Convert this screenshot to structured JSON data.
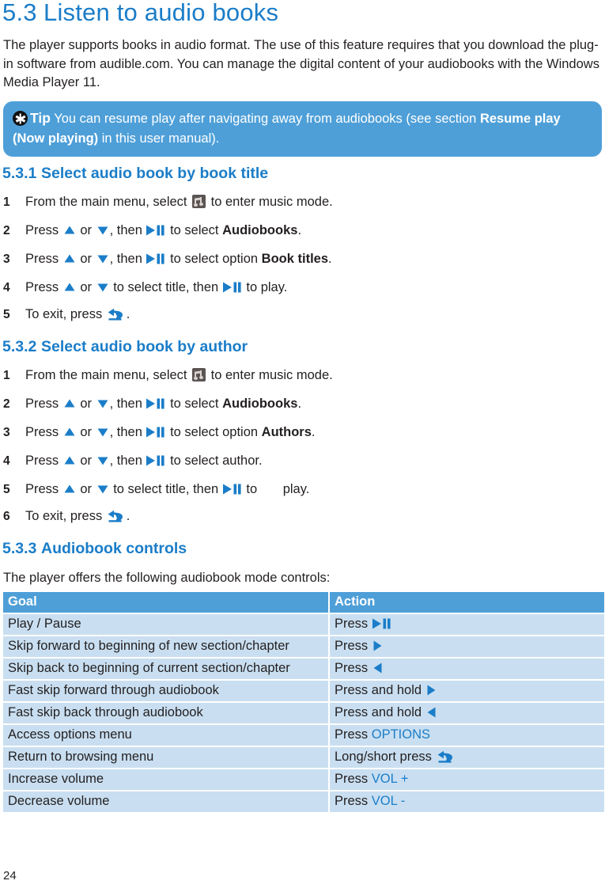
{
  "colors": {
    "heading_blue": "#1b7dc8",
    "tip_bg": "#4e9fd8",
    "table_header_bg": "#4e9fd8",
    "table_row_bg": "#c9dff1",
    "text": "#231f20",
    "music_icon_bg": "#5a5453"
  },
  "section": {
    "number": "5.3",
    "title": "Listen to audio books",
    "intro": "The player supports books in audio format. The use of this feature requires that you download the plug-in software from audible.com. You can manage the digital content of your audiobooks with the Windows Media Player 11."
  },
  "tip": {
    "icon": "asterisk-icon",
    "label": "Tip",
    "text_1": "You can resume play after navigating away from audiobooks (see section ",
    "bold_1": "Resume play (Now playing)",
    "text_2": " in this user manual)."
  },
  "subsections": [
    {
      "number": "5.3.1",
      "title": "Select audio book by book title",
      "steps": [
        {
          "n": "1",
          "parts": [
            {
              "t": "text",
              "v": "From the main menu, select "
            },
            {
              "t": "icon",
              "v": "music-mode-icon"
            },
            {
              "t": "text",
              "v": " to enter music mode."
            }
          ]
        },
        {
          "n": "2",
          "parts": [
            {
              "t": "text",
              "v": "Press "
            },
            {
              "t": "icon",
              "v": "arrow-up-icon"
            },
            {
              "t": "text",
              "v": " or "
            },
            {
              "t": "icon",
              "v": "arrow-down-icon"
            },
            {
              "t": "text",
              "v": ", then "
            },
            {
              "t": "icon",
              "v": "play-pause-icon"
            },
            {
              "t": "text",
              "v": " to select "
            },
            {
              "t": "bold",
              "v": "Audiobooks"
            },
            {
              "t": "text",
              "v": "."
            }
          ]
        },
        {
          "n": "3",
          "parts": [
            {
              "t": "text",
              "v": "Press "
            },
            {
              "t": "icon",
              "v": "arrow-up-icon"
            },
            {
              "t": "text",
              "v": " or "
            },
            {
              "t": "icon",
              "v": "arrow-down-icon"
            },
            {
              "t": "text",
              "v": ", then "
            },
            {
              "t": "icon",
              "v": "play-pause-icon"
            },
            {
              "t": "text",
              "v": " to select option "
            },
            {
              "t": "bold",
              "v": "Book titles"
            },
            {
              "t": "text",
              "v": "."
            }
          ]
        },
        {
          "n": "4",
          "parts": [
            {
              "t": "text",
              "v": "Press "
            },
            {
              "t": "icon",
              "v": "arrow-up-icon"
            },
            {
              "t": "text",
              "v": " or "
            },
            {
              "t": "icon",
              "v": "arrow-down-icon"
            },
            {
              "t": "text",
              "v": " to select title, then "
            },
            {
              "t": "icon",
              "v": "play-pause-icon"
            },
            {
              "t": "text",
              "v": " to play."
            }
          ]
        },
        {
          "n": "5",
          "parts": [
            {
              "t": "text",
              "v": "To exit, press "
            },
            {
              "t": "icon",
              "v": "back-arrow-icon"
            },
            {
              "t": "text",
              "v": "."
            }
          ]
        }
      ]
    },
    {
      "number": "5.3.2",
      "title": "Select audio book by author",
      "steps": [
        {
          "n": "1",
          "parts": [
            {
              "t": "text",
              "v": "From the main menu, select "
            },
            {
              "t": "icon",
              "v": "music-mode-icon"
            },
            {
              "t": "text",
              "v": " to enter music mode."
            }
          ]
        },
        {
          "n": "2",
          "parts": [
            {
              "t": "text",
              "v": "Press "
            },
            {
              "t": "icon",
              "v": "arrow-up-icon"
            },
            {
              "t": "text",
              "v": " or "
            },
            {
              "t": "icon",
              "v": "arrow-down-icon"
            },
            {
              "t": "text",
              "v": ", then "
            },
            {
              "t": "icon",
              "v": "play-pause-icon"
            },
            {
              "t": "text",
              "v": " to select "
            },
            {
              "t": "bold",
              "v": "Audiobooks"
            },
            {
              "t": "text",
              "v": "."
            }
          ]
        },
        {
          "n": "3",
          "parts": [
            {
              "t": "text",
              "v": "Press "
            },
            {
              "t": "icon",
              "v": "arrow-up-icon"
            },
            {
              "t": "text",
              "v": " or "
            },
            {
              "t": "icon",
              "v": "arrow-down-icon"
            },
            {
              "t": "text",
              "v": ", then "
            },
            {
              "t": "icon",
              "v": "play-pause-icon"
            },
            {
              "t": "text",
              "v": " to select option "
            },
            {
              "t": "bold",
              "v": "Authors"
            },
            {
              "t": "text",
              "v": "."
            }
          ]
        },
        {
          "n": "4",
          "parts": [
            {
              "t": "text",
              "v": "Press "
            },
            {
              "t": "icon",
              "v": "arrow-up-icon"
            },
            {
              "t": "text",
              "v": " or "
            },
            {
              "t": "icon",
              "v": "arrow-down-icon"
            },
            {
              "t": "text",
              "v": ", then "
            },
            {
              "t": "icon",
              "v": "play-pause-icon"
            },
            {
              "t": "text",
              "v": " to select author."
            }
          ]
        },
        {
          "n": "5",
          "parts": [
            {
              "t": "text",
              "v": "Press "
            },
            {
              "t": "icon",
              "v": "arrow-up-icon"
            },
            {
              "t": "text",
              "v": " or "
            },
            {
              "t": "icon",
              "v": "arrow-down-icon"
            },
            {
              "t": "text",
              "v": " to select title, then "
            },
            {
              "t": "icon",
              "v": "play-pause-icon"
            },
            {
              "t": "text",
              "v": " to "
            },
            {
              "t": "gap",
              "v": ""
            },
            {
              "t": "text",
              "v": "play."
            }
          ]
        },
        {
          "n": "6",
          "parts": [
            {
              "t": "text",
              "v": "To exit, press "
            },
            {
              "t": "icon",
              "v": "back-arrow-icon"
            },
            {
              "t": "text",
              "v": "."
            }
          ]
        }
      ]
    },
    {
      "number": "5.3.3",
      "title": "Audiobook controls",
      "intro": "The player offers the following audiobook mode controls:"
    }
  ],
  "table": {
    "headers": [
      "Goal",
      "Action"
    ],
    "rows": [
      {
        "goal": "Play / Pause",
        "action": [
          {
            "t": "text",
            "v": "Press "
          },
          {
            "t": "icon",
            "v": "play-pause-icon"
          }
        ]
      },
      {
        "goal": "Skip forward to beginning of new section/chapter",
        "action": [
          {
            "t": "text",
            "v": "Press "
          },
          {
            "t": "icon",
            "v": "arrow-right-icon"
          }
        ]
      },
      {
        "goal": "Skip back to beginning of current section/chapter",
        "action": [
          {
            "t": "text",
            "v": "Press "
          },
          {
            "t": "icon",
            "v": "arrow-left-icon"
          }
        ]
      },
      {
        "goal": "Fast skip forward through audiobook",
        "action": [
          {
            "t": "text",
            "v": "Press and hold "
          },
          {
            "t": "icon",
            "v": "arrow-right-icon"
          }
        ]
      },
      {
        "goal": "Fast skip back through audiobook",
        "action": [
          {
            "t": "text",
            "v": "Press and hold "
          },
          {
            "t": "icon",
            "v": "arrow-left-icon"
          }
        ]
      },
      {
        "goal": "Access options menu",
        "action": [
          {
            "t": "text",
            "v": "Press "
          },
          {
            "t": "blue",
            "v": "OPTIONS"
          }
        ]
      },
      {
        "goal": "Return to browsing menu",
        "action": [
          {
            "t": "text",
            "v": "Long/short press "
          },
          {
            "t": "icon",
            "v": "back-arrow-icon"
          }
        ]
      },
      {
        "goal": "Increase volume",
        "action": [
          {
            "t": "text",
            "v": "Press "
          },
          {
            "t": "blue",
            "v": "VOL +"
          }
        ]
      },
      {
        "goal": "Decrease volume",
        "action": [
          {
            "t": "text",
            "v": "Press "
          },
          {
            "t": "blue",
            "v": "VOL -"
          }
        ]
      }
    ]
  },
  "footer": {
    "page_number": "24"
  }
}
